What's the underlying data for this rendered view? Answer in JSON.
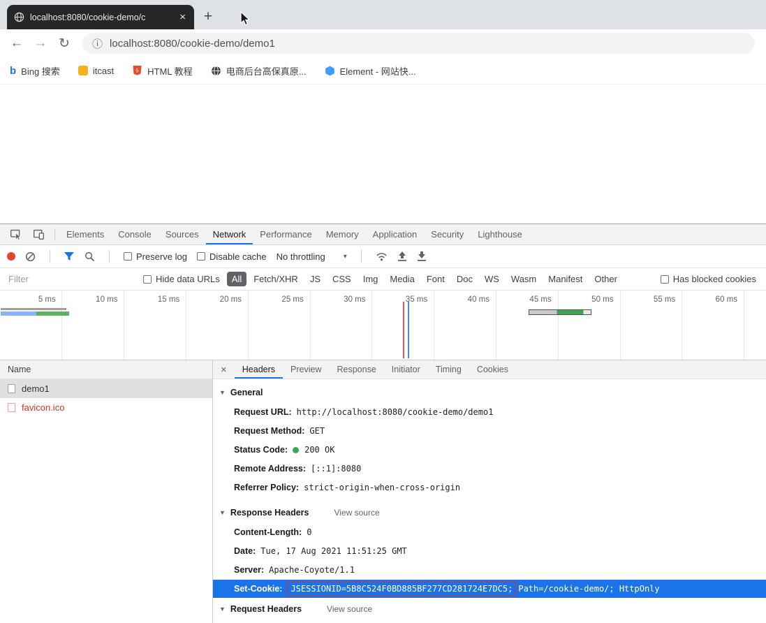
{
  "icons": {
    "close": "×",
    "new_tab": "+",
    "back": "←",
    "forward": "→",
    "reload": "↻",
    "info": "ⓘ",
    "caret_down": "▾",
    "section_caret": "▼"
  },
  "colors": {
    "accent": "#1a73e8",
    "error": "#d93025",
    "selection_row": "#1a73e8",
    "annotation": "#d93025",
    "status_green": "#3aa757",
    "chip_selected": "#5f6368"
  },
  "browser": {
    "tab_title": "localhost:8080/cookie-demo/c",
    "url": "localhost:8080/cookie-demo/demo1",
    "bookmarks": [
      {
        "label": "Bing 搜索",
        "icon_text": "b"
      },
      {
        "label": "itcast"
      },
      {
        "label": "HTML 教程"
      },
      {
        "label": "电商后台高保真原..."
      },
      {
        "label": "Element - 网站快..."
      }
    ]
  },
  "devtools": {
    "main_tabs": [
      "Elements",
      "Console",
      "Sources",
      "Network",
      "Performance",
      "Memory",
      "Application",
      "Security",
      "Lighthouse"
    ],
    "active_main_tab": "Network",
    "toolbar": {
      "preserve_log": "Preserve log",
      "disable_cache": "Disable cache",
      "throttling": "No throttling"
    },
    "filter": {
      "placeholder": "Filter",
      "hide_data_urls": "Hide data URLs",
      "chips": [
        "All",
        "Fetch/XHR",
        "JS",
        "CSS",
        "Img",
        "Media",
        "Font",
        "Doc",
        "WS",
        "Wasm",
        "Manifest",
        "Other"
      ],
      "active_chip": "All",
      "has_blocked_cookies": "Has blocked cookies"
    },
    "timeline_ticks": [
      "5 ms",
      "10 ms",
      "15 ms",
      "20 ms",
      "25 ms",
      "30 ms",
      "35 ms",
      "40 ms",
      "45 ms",
      "50 ms",
      "55 ms",
      "60 ms"
    ],
    "requests": {
      "name_header": "Name",
      "rows": [
        {
          "name": "demo1",
          "selected": true,
          "error": false
        },
        {
          "name": "favicon.ico",
          "selected": false,
          "error": true
        }
      ]
    },
    "detail_tabs": [
      "Headers",
      "Preview",
      "Response",
      "Initiator",
      "Timing",
      "Cookies"
    ],
    "active_detail_tab": "Headers",
    "headers_panel": {
      "general_title": "General",
      "general": [
        {
          "key": "Request URL:",
          "value": "http://localhost:8080/cookie-demo/demo1"
        },
        {
          "key": "Request Method:",
          "value": "GET"
        },
        {
          "key": "Status Code:",
          "value": "200 OK"
        },
        {
          "key": "Remote Address:",
          "value": "[::1]:8080"
        },
        {
          "key": "Referrer Policy:",
          "value": "strict-origin-when-cross-origin"
        }
      ],
      "response_title": "Response Headers",
      "view_source": "View source",
      "response": [
        {
          "key": "Content-Length:",
          "value": "0"
        },
        {
          "key": "Date:",
          "value": "Tue, 17 Aug 2021 11:51:25 GMT"
        },
        {
          "key": "Server:",
          "value": "Apache-Coyote/1.1"
        }
      ],
      "set_cookie": {
        "key": "Set-Cookie:",
        "boxed": "JSESSIONID=5B8C524F0BD885BF277CD281724E7DC5;",
        "rest": "Path=/cookie-demo/; HttpOnly"
      },
      "request_title": "Request Headers"
    }
  }
}
